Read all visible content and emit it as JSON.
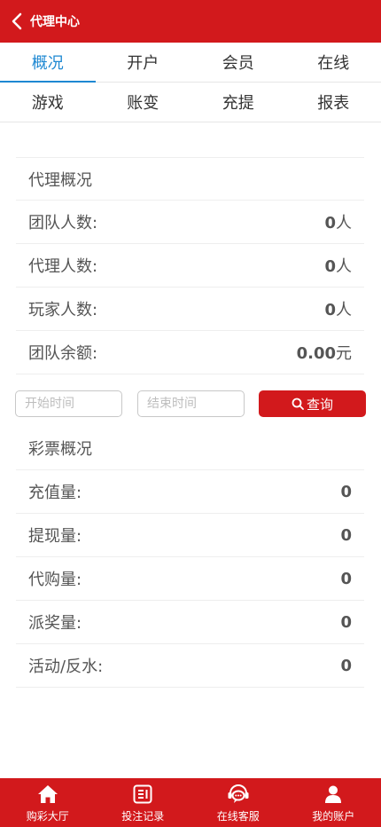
{
  "header": {
    "title": "代理中心",
    "back_icon": "chevron-left-icon"
  },
  "tabs": {
    "row1": [
      {
        "label": "概况",
        "active": true
      },
      {
        "label": "开户",
        "active": false
      },
      {
        "label": "会员",
        "active": false
      },
      {
        "label": "在线",
        "active": false
      }
    ],
    "row2": [
      {
        "label": "游戏",
        "active": false
      },
      {
        "label": "账变",
        "active": false
      },
      {
        "label": "充提",
        "active": false
      },
      {
        "label": "报表",
        "active": false
      }
    ]
  },
  "agent_overview": {
    "title": "代理概况",
    "items": [
      {
        "label": "团队人数:",
        "value": "0",
        "unit": "人"
      },
      {
        "label": "代理人数:",
        "value": "0",
        "unit": "人"
      },
      {
        "label": "玩家人数:",
        "value": "0",
        "unit": "人"
      },
      {
        "label": "团队余额:",
        "value": "0.00",
        "unit": "元"
      }
    ]
  },
  "filter": {
    "start_placeholder": "开始时间",
    "end_placeholder": "结束时间",
    "search_label": "查询"
  },
  "lottery_overview": {
    "title": "彩票概况",
    "items": [
      {
        "label": "充值量:",
        "value": "0"
      },
      {
        "label": "提现量:",
        "value": "0"
      },
      {
        "label": "代购量:",
        "value": "0"
      },
      {
        "label": "派奖量:",
        "value": "0"
      },
      {
        "label": "活动/反水:",
        "value": "0"
      }
    ]
  },
  "bottom_nav": [
    {
      "label": "购彩大厅",
      "icon": "home-icon"
    },
    {
      "label": "投注记录",
      "icon": "list-icon"
    },
    {
      "label": "在线客服",
      "icon": "chat-icon"
    },
    {
      "label": "我的账户",
      "icon": "user-icon"
    }
  ],
  "colors": {
    "brand": "#d2191c",
    "active_tab": "#1e88d2"
  }
}
